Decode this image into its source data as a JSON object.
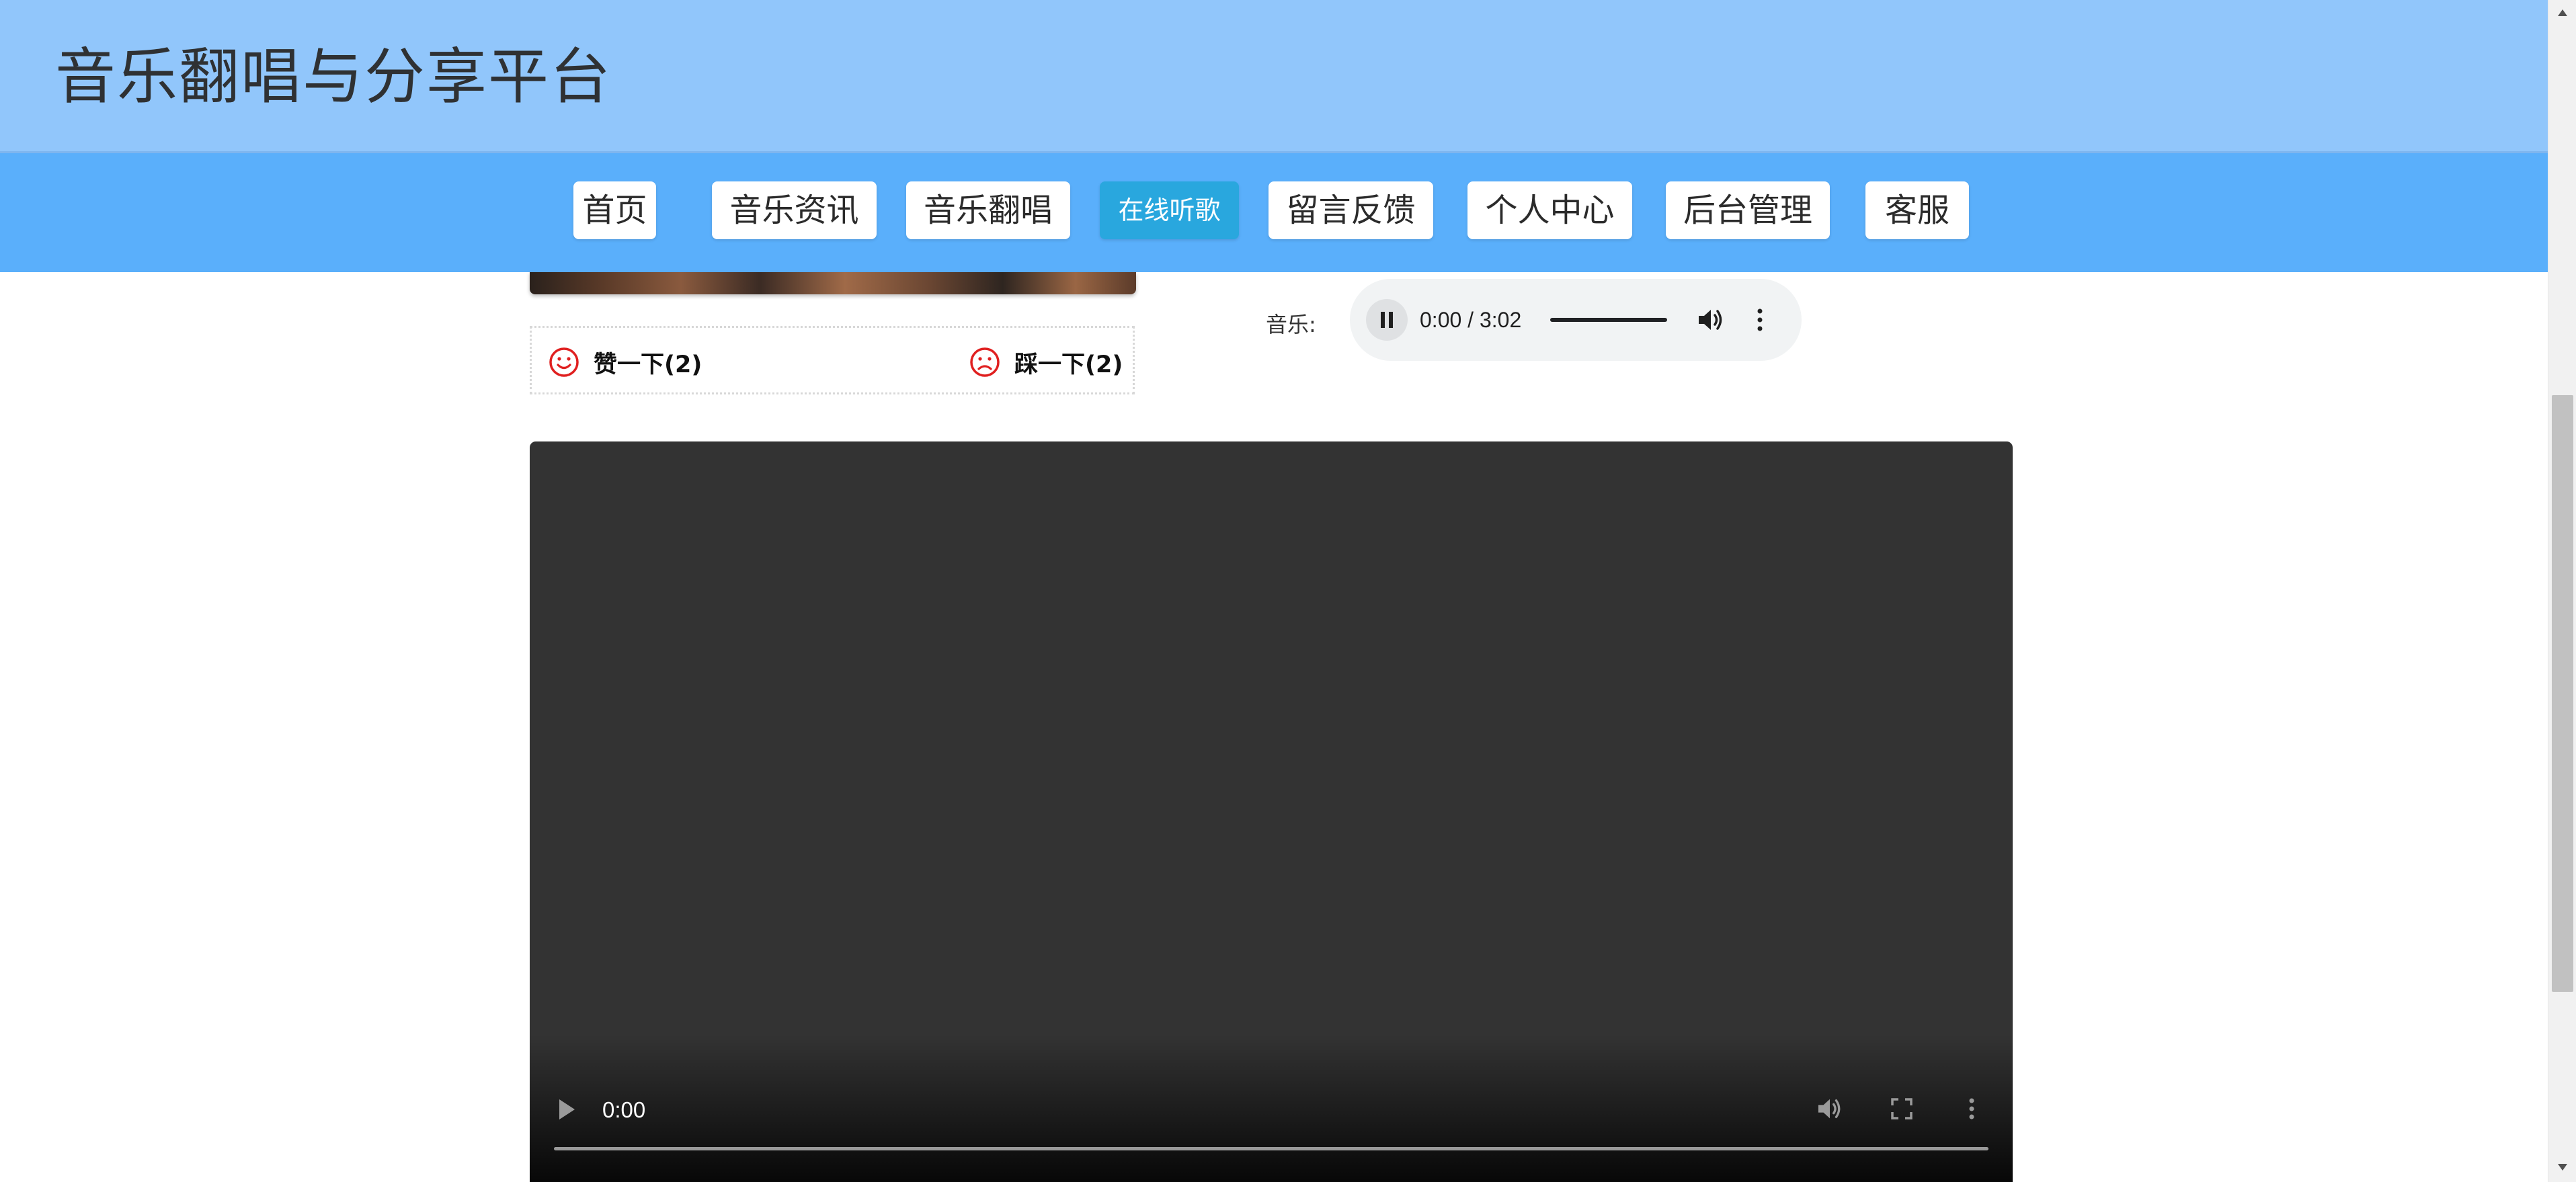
{
  "header": {
    "title": "音乐翻唱与分享平台"
  },
  "nav": {
    "items": [
      {
        "label": "首页",
        "active": false
      },
      {
        "label": "音乐资讯",
        "active": false
      },
      {
        "label": "音乐翻唱",
        "active": false
      },
      {
        "label": "在线听歌",
        "active": true
      },
      {
        "label": "留言反馈",
        "active": false
      },
      {
        "label": "个人中心",
        "active": false
      },
      {
        "label": "后台管理",
        "active": false
      },
      {
        "label": "客服",
        "active": false
      }
    ]
  },
  "votes": {
    "like_label": "赞一下(2)",
    "dislike_label": "踩一下(2)"
  },
  "music": {
    "label": "音乐:",
    "time": "0:00 / 3:02",
    "state": "playing"
  },
  "video": {
    "time": "0:00"
  },
  "colors": {
    "header_bg": "#91c6fb",
    "nav_bg": "#5aaffb",
    "nav_active": "#29a7de",
    "vote_icon": "#e02020"
  },
  "icons": {
    "like": "smile-icon",
    "dislike": "sad-icon",
    "audio_control": "pause-icon",
    "volume": "volume-icon",
    "more": "more-vertical-icon",
    "video_play": "play-icon",
    "fullscreen": "fullscreen-icon"
  }
}
